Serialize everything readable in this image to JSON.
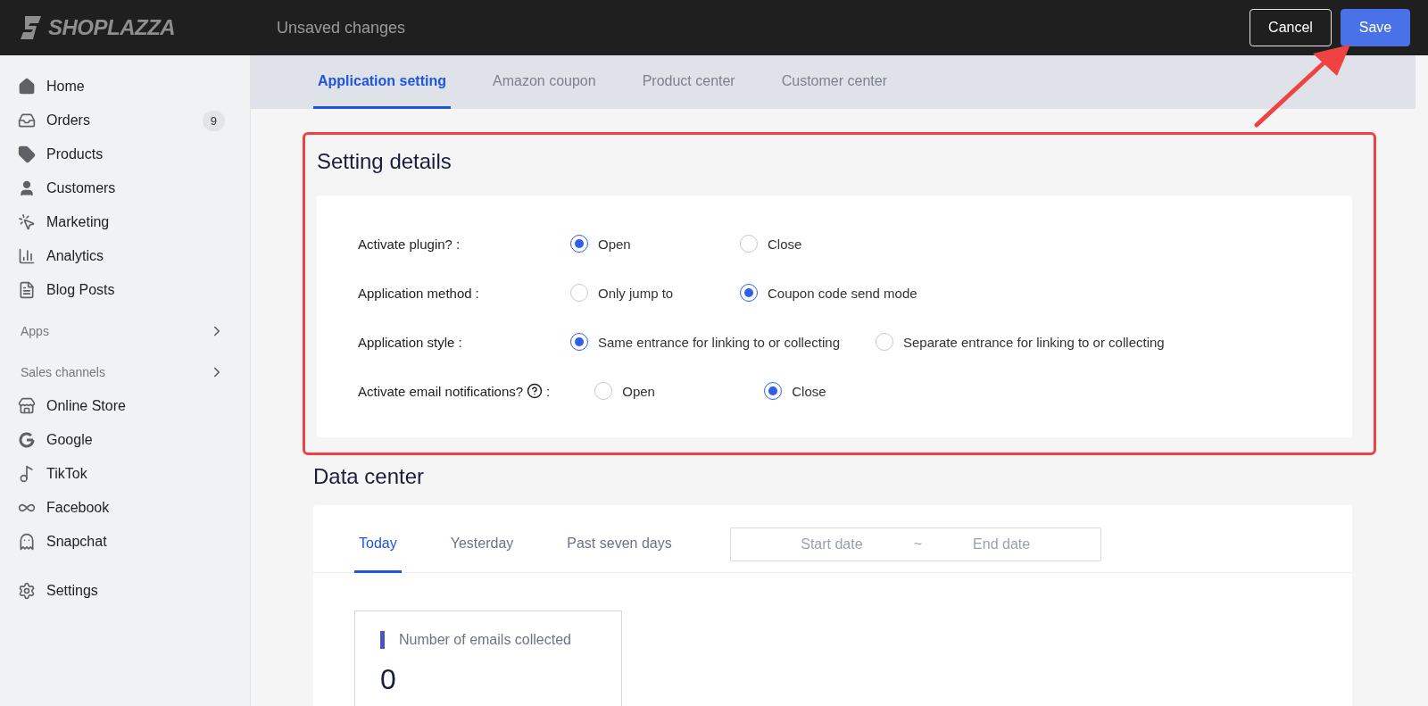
{
  "header": {
    "logo": "SHOPLAZZA",
    "title": "Unsaved changes",
    "buttons": [
      {
        "label": "Cancel",
        "kind": "secondary"
      },
      {
        "label": "Save",
        "kind": "primary"
      }
    ]
  },
  "sidebar": {
    "items": [
      {
        "kind": "item",
        "label": "Home"
      },
      {
        "kind": "item",
        "label": "Orders",
        "badge": "9"
      },
      {
        "kind": "item",
        "label": "Products"
      },
      {
        "kind": "item",
        "label": "Customers"
      },
      {
        "kind": "item",
        "label": "Marketing"
      },
      {
        "kind": "item",
        "label": "Analytics"
      },
      {
        "kind": "item",
        "label": "Blog Posts"
      },
      {
        "kind": "section",
        "label": "Apps"
      },
      {
        "kind": "section",
        "label": "Sales channels"
      },
      {
        "kind": "item",
        "label": "Online Store"
      },
      {
        "kind": "item",
        "label": "Google"
      },
      {
        "kind": "item",
        "label": "TikTok"
      },
      {
        "kind": "item",
        "label": "Facebook"
      },
      {
        "kind": "item",
        "label": "Snapchat"
      },
      {
        "kind": "bottom",
        "label": "Settings"
      }
    ]
  },
  "tabs": [
    {
      "label": "Application setting",
      "selected": true
    },
    {
      "label": "Amazon coupon",
      "selected": false
    },
    {
      "label": "Product center",
      "selected": false
    },
    {
      "label": "Customer center",
      "selected": false
    }
  ],
  "settings": {
    "title": "Setting details",
    "rows": [
      {
        "label": "Activate plugin?",
        "colon": ":",
        "options": [
          {
            "label": "Open",
            "selected": true
          },
          {
            "label": "Close",
            "selected": false
          }
        ]
      },
      {
        "label": "Application method",
        "colon": ":",
        "options": [
          {
            "label": "Only jump to",
            "selected": false
          },
          {
            "label": "Coupon code send mode",
            "selected": true
          }
        ]
      },
      {
        "label": "Application style",
        "colon": ":",
        "options": [
          {
            "label": "Same entrance for linking to or collecting",
            "selected": true
          },
          {
            "label": "Separate entrance for linking to or collecting",
            "selected": false
          }
        ]
      },
      {
        "label": "Activate email notifications?",
        "help": true,
        "colon": ":",
        "options": [
          {
            "label": "Open",
            "selected": false
          },
          {
            "label": "Close",
            "selected": true
          }
        ]
      }
    ]
  },
  "data_center": {
    "title": "Data center",
    "tabs": [
      {
        "label": "Today",
        "selected": true
      },
      {
        "label": "Yesterday",
        "selected": false
      },
      {
        "label": "Past seven days",
        "selected": false
      }
    ],
    "date_range": {
      "start_placeholder": "Start date",
      "separator": "~",
      "end_placeholder": "End date"
    },
    "stats": [
      {
        "label": "Number of emails collected",
        "value": "0"
      }
    ]
  }
}
